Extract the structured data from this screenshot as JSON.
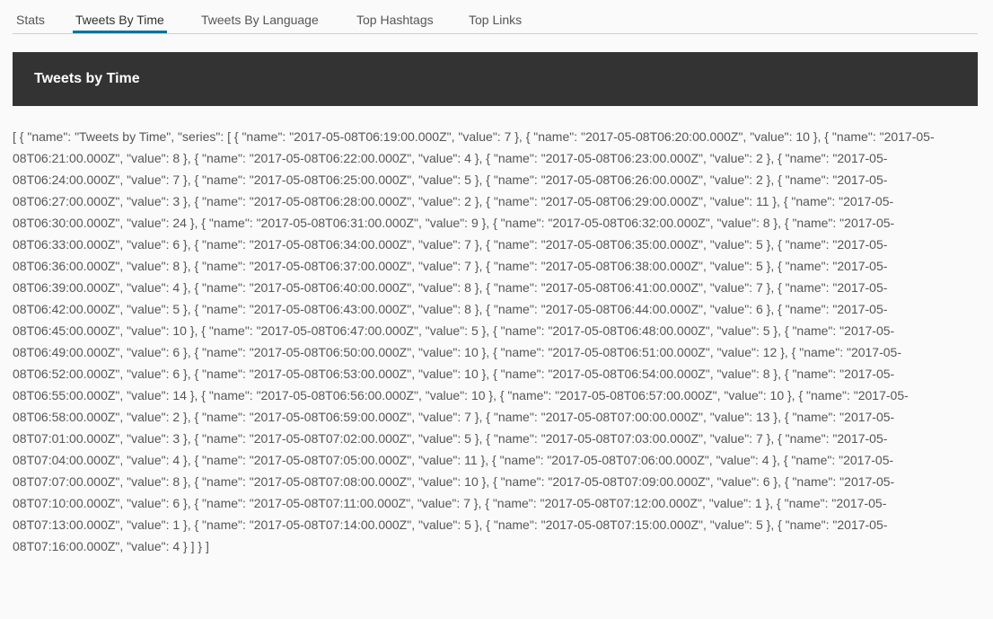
{
  "tabs": [
    {
      "label": "Stats",
      "active": false
    },
    {
      "label": "Tweets By Time",
      "active": true
    },
    {
      "label": "Tweets By Language",
      "active": false
    },
    {
      "label": "Top Hashtags",
      "active": false
    },
    {
      "label": "Top Links",
      "active": false
    }
  ],
  "colors": {
    "accent": "#0072a3",
    "header_bg": "#333333",
    "page_bg": "#fafafa",
    "text": "#565656"
  },
  "card": {
    "title": "Tweets by Time"
  },
  "output": {
    "series_name": "Tweets by Time",
    "series": [
      {
        "name": "2017-05-08T06:19:00.000Z",
        "value": 7
      },
      {
        "name": "2017-05-08T06:20:00.000Z",
        "value": 10
      },
      {
        "name": "2017-05-08T06:21:00.000Z",
        "value": 8
      },
      {
        "name": "2017-05-08T06:22:00.000Z",
        "value": 4
      },
      {
        "name": "2017-05-08T06:23:00.000Z",
        "value": 2
      },
      {
        "name": "2017-05-08T06:24:00.000Z",
        "value": 7
      },
      {
        "name": "2017-05-08T06:25:00.000Z",
        "value": 5
      },
      {
        "name": "2017-05-08T06:26:00.000Z",
        "value": 2
      },
      {
        "name": "2017-05-08T06:27:00.000Z",
        "value": 3
      },
      {
        "name": "2017-05-08T06:28:00.000Z",
        "value": 2
      },
      {
        "name": "2017-05-08T06:29:00.000Z",
        "value": 11
      },
      {
        "name": "2017-05-08T06:30:00.000Z",
        "value": 24
      },
      {
        "name": "2017-05-08T06:31:00.000Z",
        "value": 9
      },
      {
        "name": "2017-05-08T06:32:00.000Z",
        "value": 8
      },
      {
        "name": "2017-05-08T06:33:00.000Z",
        "value": 6
      },
      {
        "name": "2017-05-08T06:34:00.000Z",
        "value": 7
      },
      {
        "name": "2017-05-08T06:35:00.000Z",
        "value": 5
      },
      {
        "name": "2017-05-08T06:36:00.000Z",
        "value": 8
      },
      {
        "name": "2017-05-08T06:37:00.000Z",
        "value": 7
      },
      {
        "name": "2017-05-08T06:38:00.000Z",
        "value": 5
      },
      {
        "name": "2017-05-08T06:39:00.000Z",
        "value": 4
      },
      {
        "name": "2017-05-08T06:40:00.000Z",
        "value": 8
      },
      {
        "name": "2017-05-08T06:41:00.000Z",
        "value": 7
      },
      {
        "name": "2017-05-08T06:42:00.000Z",
        "value": 5
      },
      {
        "name": "2017-05-08T06:43:00.000Z",
        "value": 8
      },
      {
        "name": "2017-05-08T06:44:00.000Z",
        "value": 6
      },
      {
        "name": "2017-05-08T06:45:00.000Z",
        "value": 10
      },
      {
        "name": "2017-05-08T06:47:00.000Z",
        "value": 5
      },
      {
        "name": "2017-05-08T06:48:00.000Z",
        "value": 5
      },
      {
        "name": "2017-05-08T06:49:00.000Z",
        "value": 6
      },
      {
        "name": "2017-05-08T06:50:00.000Z",
        "value": 10
      },
      {
        "name": "2017-05-08T06:51:00.000Z",
        "value": 12
      },
      {
        "name": "2017-05-08T06:52:00.000Z",
        "value": 6
      },
      {
        "name": "2017-05-08T06:53:00.000Z",
        "value": 10
      },
      {
        "name": "2017-05-08T06:54:00.000Z",
        "value": 8
      },
      {
        "name": "2017-05-08T06:55:00.000Z",
        "value": 14
      },
      {
        "name": "2017-05-08T06:56:00.000Z",
        "value": 10
      },
      {
        "name": "2017-05-08T06:57:00.000Z",
        "value": 10
      },
      {
        "name": "2017-05-08T06:58:00.000Z",
        "value": 2
      },
      {
        "name": "2017-05-08T06:59:00.000Z",
        "value": 7
      },
      {
        "name": "2017-05-08T07:00:00.000Z",
        "value": 13
      },
      {
        "name": "2017-05-08T07:01:00.000Z",
        "value": 3
      },
      {
        "name": "2017-05-08T07:02:00.000Z",
        "value": 5
      },
      {
        "name": "2017-05-08T07:03:00.000Z",
        "value": 7
      },
      {
        "name": "2017-05-08T07:04:00.000Z",
        "value": 4
      },
      {
        "name": "2017-05-08T07:05:00.000Z",
        "value": 11
      },
      {
        "name": "2017-05-08T07:06:00.000Z",
        "value": 4
      },
      {
        "name": "2017-05-08T07:07:00.000Z",
        "value": 8
      },
      {
        "name": "2017-05-08T07:08:00.000Z",
        "value": 10
      },
      {
        "name": "2017-05-08T07:09:00.000Z",
        "value": 6
      },
      {
        "name": "2017-05-08T07:10:00.000Z",
        "value": 6
      },
      {
        "name": "2017-05-08T07:11:00.000Z",
        "value": 7
      },
      {
        "name": "2017-05-08T07:12:00.000Z",
        "value": 1
      },
      {
        "name": "2017-05-08T07:13:00.000Z",
        "value": 1
      },
      {
        "name": "2017-05-08T07:14:00.000Z",
        "value": 5
      },
      {
        "name": "2017-05-08T07:15:00.000Z",
        "value": 5
      },
      {
        "name": "2017-05-08T07:16:00.000Z",
        "value": 4
      }
    ]
  }
}
